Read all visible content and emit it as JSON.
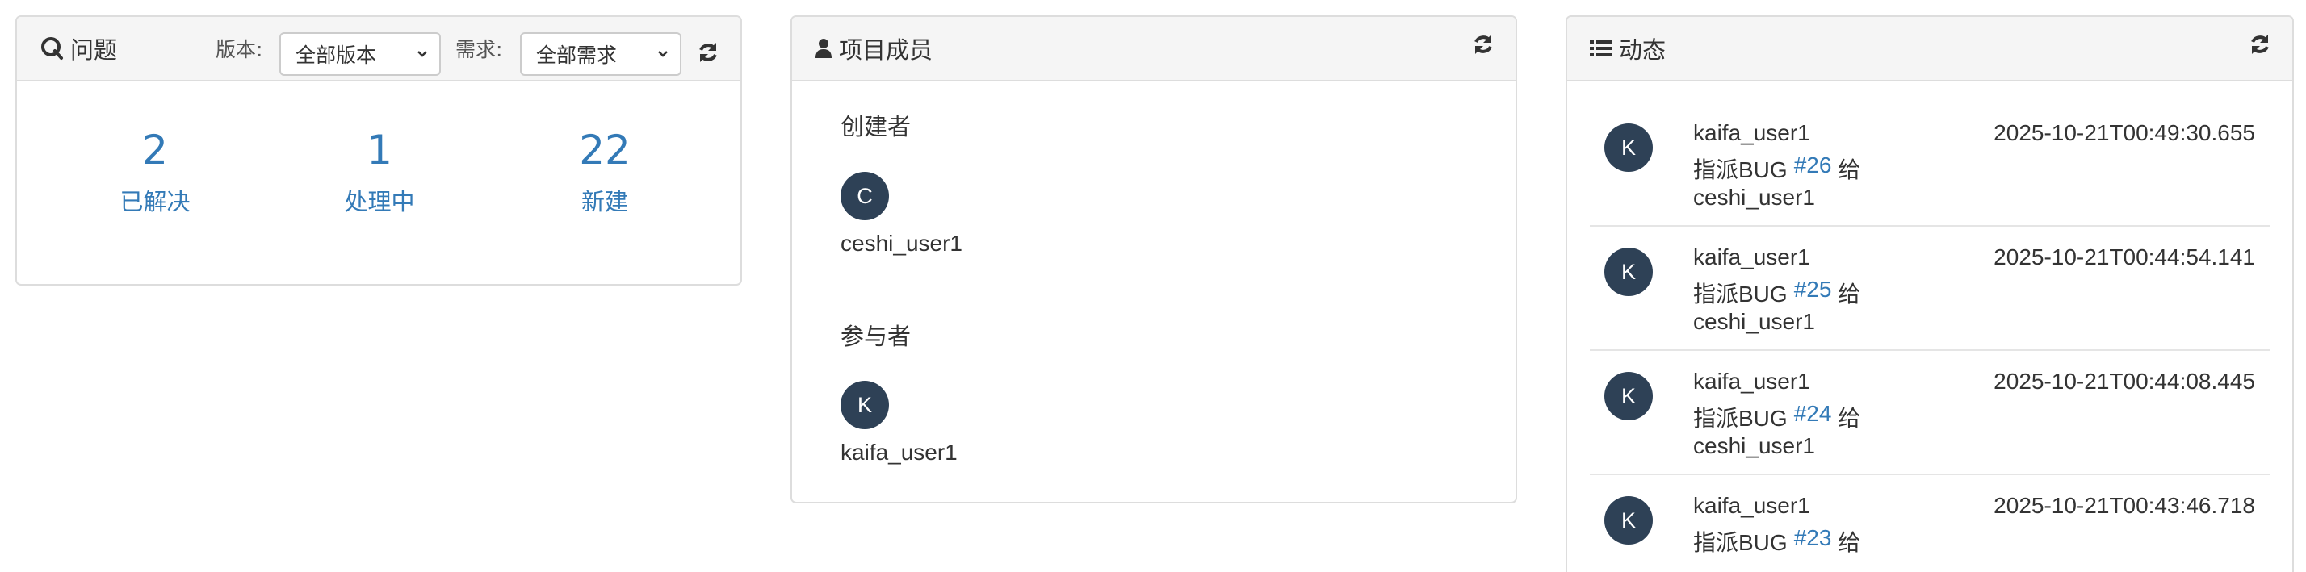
{
  "issues_panel": {
    "title": "问题",
    "title_icon": "qq-icon",
    "version_label": "版本:",
    "version_select": "全部版本",
    "requirement_label": "需求:",
    "requirement_select": "全部需求",
    "stats": [
      {
        "value": "2",
        "label": "已解决"
      },
      {
        "value": "1",
        "label": "处理中"
      },
      {
        "value": "22",
        "label": "新建"
      }
    ]
  },
  "members_panel": {
    "title": "项目成员",
    "title_icon": "user-icon",
    "creator_label": "创建者",
    "creator": {
      "initial": "C",
      "name": "ceshi_user1"
    },
    "participant_label": "参与者",
    "participant": {
      "initial": "K",
      "name": "kaifa_user1"
    }
  },
  "activity_panel": {
    "title": "动态",
    "title_icon": "list-icon",
    "items": [
      {
        "initial": "K",
        "user": "kaifa_user1",
        "time": "2025-10-21T00:49:30.655",
        "action": "指派BUG",
        "issue": "#26",
        "suffix": "给",
        "target": "ceshi_user1"
      },
      {
        "initial": "K",
        "user": "kaifa_user1",
        "time": "2025-10-21T00:44:54.141",
        "action": "指派BUG",
        "issue": "#25",
        "suffix": "给",
        "target": "ceshi_user1"
      },
      {
        "initial": "K",
        "user": "kaifa_user1",
        "time": "2025-10-21T00:44:08.445",
        "action": "指派BUG",
        "issue": "#24",
        "suffix": "给",
        "target": "ceshi_user1"
      },
      {
        "initial": "K",
        "user": "kaifa_user1",
        "time": "2025-10-21T00:43:46.718",
        "action": "指派BUG",
        "issue": "#23",
        "suffix": "给",
        "target": ""
      }
    ]
  },
  "colors": {
    "link": "#337ab7",
    "avatar_bg": "#2e4156",
    "heading_bg": "#f5f5f5",
    "border": "#dddddd"
  }
}
